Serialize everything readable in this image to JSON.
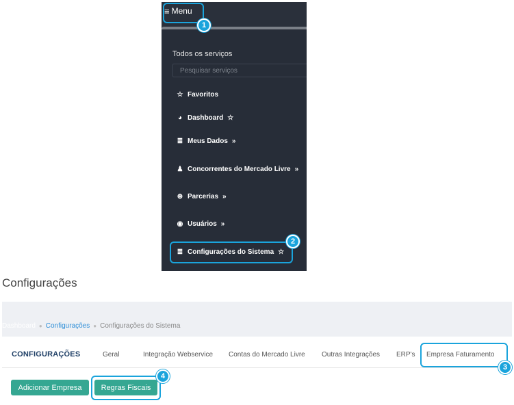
{
  "menu_panel": {
    "menu_button_label": "Menu",
    "menu_icon": "hamburger-icon",
    "title": "Todos os serviços",
    "search_placeholder": "Pesquisar serviços",
    "items": [
      {
        "label": "Favoritos",
        "icon": "star-outline-icon",
        "suffix": ""
      },
      {
        "label": "Dashboard",
        "icon": "pie-chart-icon",
        "suffix": "☆"
      },
      {
        "label": "Meus Dados",
        "icon": "database-icon",
        "suffix": "»"
      },
      {
        "label": "Concorrentes do Mercado Livre",
        "icon": "user-icon",
        "suffix": "»"
      },
      {
        "label": "Parcerias",
        "icon": "handshake-icon",
        "suffix": "»"
      },
      {
        "label": "Usuários",
        "icon": "user-circle-icon",
        "suffix": "»"
      },
      {
        "label": "Configurações do Sistema",
        "icon": "database-icon",
        "suffix": "☆"
      }
    ]
  },
  "callouts": [
    "1",
    "2",
    "3",
    "4"
  ],
  "page": {
    "title": "Configurações",
    "breadcrumb": {
      "first": "Dashboard",
      "second": "Configurações",
      "current": "Configurações do Sistema"
    },
    "section_label": "CONFIGURAÇÕES",
    "tabs": [
      "Geral",
      "Integração Webservice",
      "Contas do Mercado Livre",
      "Outras Integrações",
      "ERP's",
      "Empresa Faturamento"
    ],
    "buttons": {
      "add_company": "Adicionar Empresa",
      "tax_rules": "Regras Fiscais"
    }
  },
  "colors": {
    "menu_background": "#272d38",
    "callout": "#1aa4dc",
    "button": "#35a792",
    "section_label": "#1f3f66",
    "link": "#2f8fd8"
  }
}
